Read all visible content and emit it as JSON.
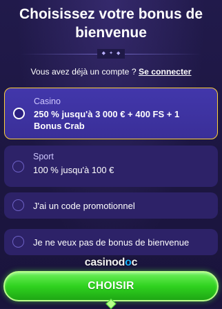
{
  "header": {
    "title": "Choisissez votre bonus de bienvenue"
  },
  "account": {
    "prompt": "Vous avez déjà un compte ?",
    "login_link": "Se connecter"
  },
  "options": [
    {
      "category": "Casino",
      "label": "250 % jusqu'à 3 000 € + 400 FS + 1 Bonus Crab",
      "selected": true
    },
    {
      "category": "Sport",
      "label": "100 % jusqu'à 100 €",
      "selected": false
    },
    {
      "label": "J'ai un code promotionnel",
      "selected": false
    },
    {
      "label": "Je ne veux pas de bonus de bienvenue",
      "selected": false
    }
  ],
  "watermark": {
    "prefix": "casinod",
    "dot": "o",
    "suffix": "c"
  },
  "cta": {
    "label": "CHOISIR"
  },
  "colors": {
    "background": "#1d1742",
    "card": "#2d2268",
    "selected_card": "#3e33a3",
    "selected_border": "#ffd23a",
    "cta_green": "#2fd21f"
  }
}
